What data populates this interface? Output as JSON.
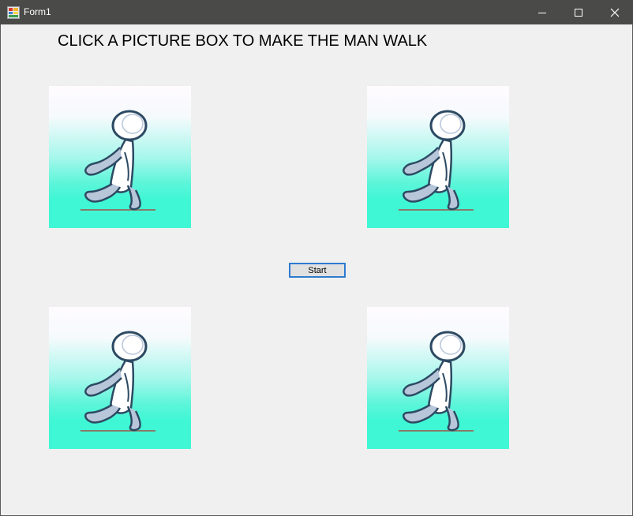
{
  "window": {
    "title": "Form1",
    "icon": "winforms-app-icon"
  },
  "titlebar_buttons": {
    "minimize_icon": "minimize-icon",
    "maximize_icon": "maximize-icon",
    "close_icon": "close-icon"
  },
  "main": {
    "heading": "CLICK A PICTURE BOX TO MAKE THE MAN WALK",
    "start_label": "Start",
    "picture_boxes": [
      {
        "icon": "walking-man-figure"
      },
      {
        "icon": "walking-man-figure"
      },
      {
        "icon": "walking-man-figure"
      },
      {
        "icon": "walking-man-figure"
      }
    ]
  },
  "colors": {
    "titlebar": "#4a4a48",
    "window_bg": "#f0f0f0",
    "picture_gradient_top": "#fffbff",
    "picture_gradient_bottom": "#3ff7d4",
    "button_border": "#2e7bd1"
  }
}
